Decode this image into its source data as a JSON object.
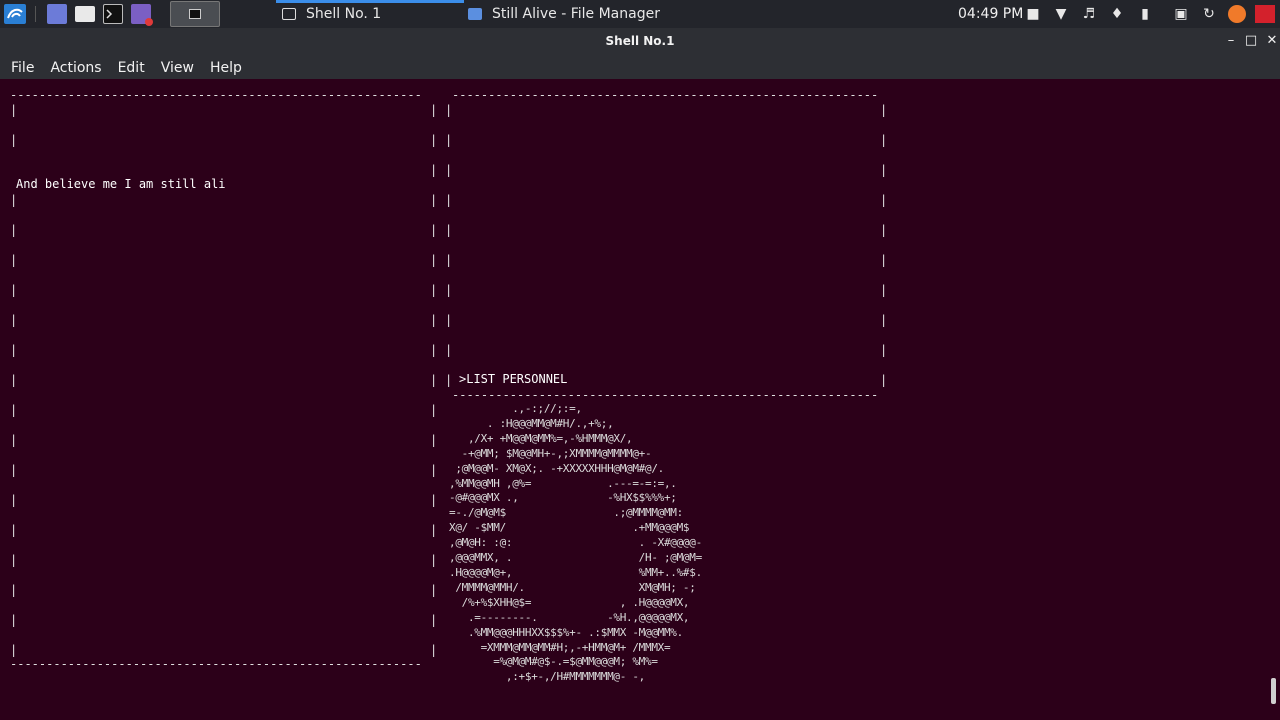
{
  "taskbar": {
    "tasks": [
      {
        "label": "Shell No. 1",
        "active": true
      },
      {
        "label": "Still Alive - File Manager",
        "active": false
      }
    ],
    "clock": "04:49 PM"
  },
  "window": {
    "title": "Shell No.1"
  },
  "menubar": {
    "items": [
      "File",
      "Actions",
      "Edit",
      "View",
      "Help"
    ]
  },
  "terminal": {
    "lyric_line": "And believe me I am still ali",
    "prompt_line": ">LIST PERSONNEL",
    "ascii_logo": "          .,-:;//;:=,\n      . :H@@@MM@M#H/.,+%;,\n   ,/X+ +M@@M@MM%=,-%HMMM@X/,\n  -+@MM; $M@@MH+-,;XMMMM@MMMM@+-\n ;@M@@M- XM@X;. -+XXXXXHHH@M@M#@/.\n,%MM@@MH ,@%=            .---=-=:=,.\n-@#@@@MX .,              -%HX$$%%%+;\n=-./@M@M$                 .;@MMMM@MM:\nX@/ -$MM/                    .+MM@@@M$\n,@M@H: :@:                    . -X#@@@@-\n,@@@MMX, .                    /H- ;@M@M=\n.H@@@@M@+,                    %MM+..%#$.\n /MMMM@MMH/.                  XM@MH; -;\n  /%+%$XHH@$=              , .H@@@@MX,\n   .=--------.           -%H.,@@@@@MX,\n   .%MM@@@HHHXX$$$%+- .:$MMX -M@@MM%.\n     =XMMM@MM@MM#H;,-+HMM@M+ /MMMX=\n       =%@M@M#@$-.=$@MM@@@M; %M%=\n         ,:+$+-,/H#MMMMMMM@- -,"
  }
}
